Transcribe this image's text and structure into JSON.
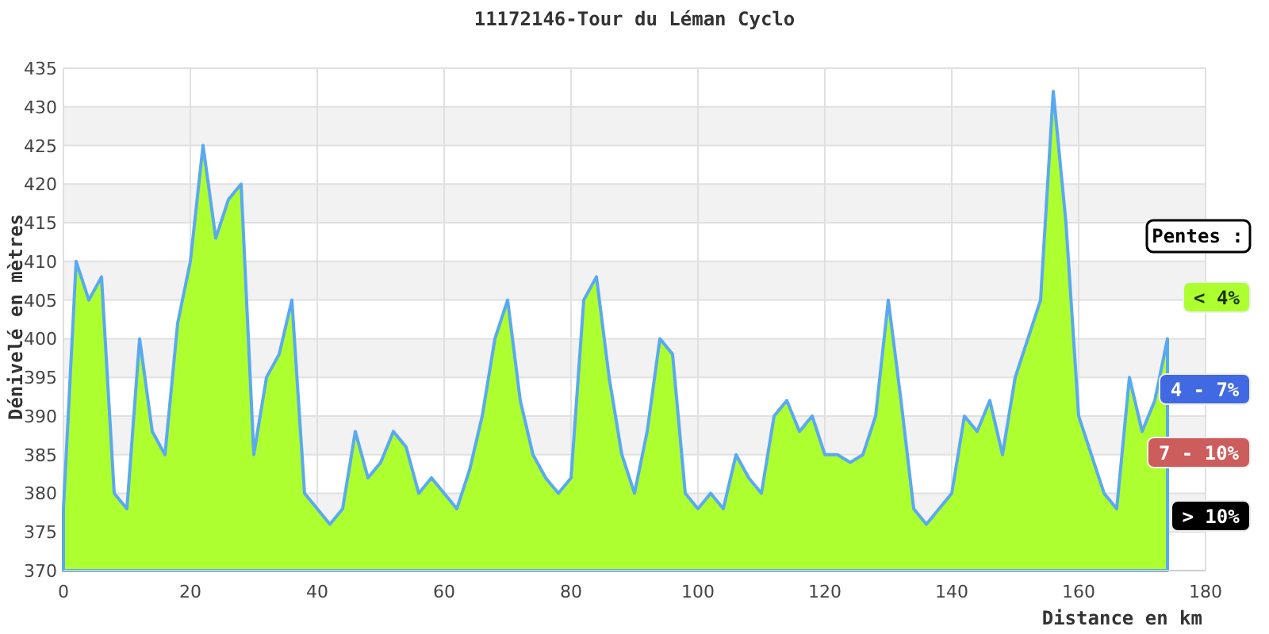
{
  "chart_data": {
    "type": "area",
    "title": "11172146-Tour du Léman Cyclo",
    "xlabel": "Distance en km",
    "ylabel": "Dénivelé en mètres",
    "x": [
      0,
      2,
      4,
      6,
      8,
      10,
      12,
      14,
      16,
      18,
      20,
      22,
      24,
      26,
      28,
      30,
      32,
      34,
      36,
      38,
      40,
      42,
      44,
      46,
      48,
      50,
      52,
      54,
      56,
      58,
      60,
      62,
      64,
      66,
      68,
      70,
      72,
      74,
      76,
      78,
      80,
      82,
      84,
      86,
      88,
      90,
      92,
      94,
      96,
      98,
      100,
      102,
      104,
      106,
      108,
      110,
      112,
      114,
      116,
      118,
      120,
      122,
      124,
      126,
      128,
      130,
      132,
      134,
      136,
      138,
      140,
      142,
      144,
      146,
      148,
      150,
      152,
      154,
      156,
      158,
      160,
      162,
      164,
      166,
      168,
      170,
      172,
      174
    ],
    "series": [
      {
        "color": "#5aa9f0",
        "values": [
          378,
          410,
          405,
          408,
          380,
          378,
          400,
          388,
          385,
          402,
          410,
          425,
          413,
          418,
          420,
          385,
          395,
          398,
          405,
          380,
          378,
          376,
          378,
          388,
          382,
          384,
          388,
          386,
          380,
          382,
          380,
          378,
          383,
          390,
          400,
          405,
          392,
          385,
          382,
          380,
          382,
          405,
          408,
          395,
          385,
          380,
          388,
          400,
          398,
          380,
          378,
          380,
          378,
          385,
          382,
          380,
          390,
          392,
          388,
          390,
          385,
          385,
          384,
          385,
          390,
          405,
          392,
          378,
          376,
          378,
          380,
          390,
          388,
          392,
          385,
          395,
          400,
          405,
          432,
          415,
          390,
          385,
          380,
          378,
          395,
          388,
          392,
          400
        ]
      }
    ],
    "grid": true,
    "xlim": [
      0,
      180
    ],
    "ylim": [
      370,
      435
    ],
    "xticks": [
      0,
      20,
      40,
      60,
      80,
      100,
      120,
      140,
      160,
      180
    ],
    "yticks": [
      370,
      375,
      380,
      385,
      390,
      395,
      400,
      405,
      410,
      415,
      420,
      425,
      430,
      435
    ]
  },
  "legend": {
    "title": "Pentes :",
    "items": [
      {
        "label": "< 4%",
        "color": "#adff2f"
      },
      {
        "label": "4 - 7%",
        "color": "#4169e1"
      },
      {
        "label": "7 - 10%",
        "color": "#cd5c5c"
      },
      {
        "label": "> 10%",
        "color": "#000000"
      }
    ]
  }
}
